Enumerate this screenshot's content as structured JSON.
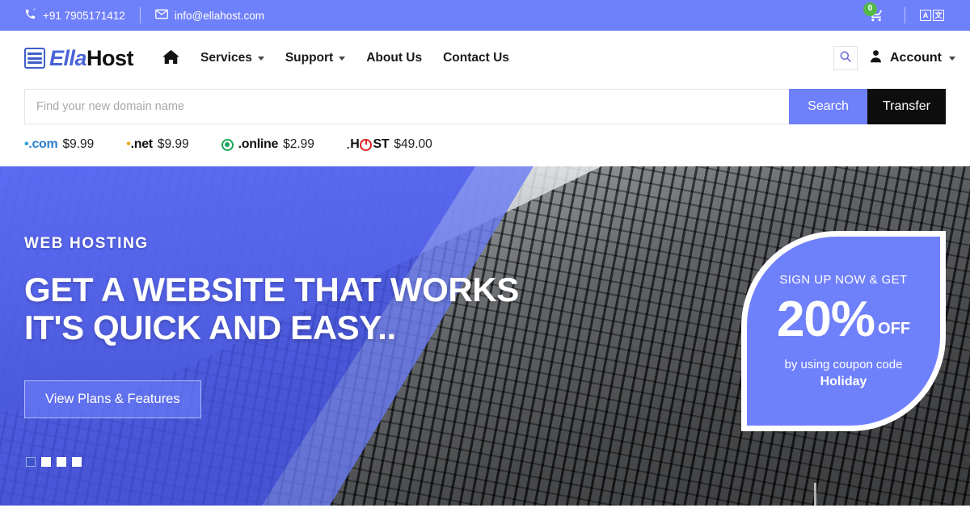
{
  "topbar": {
    "phone": "+91 7905171412",
    "phone_icon": "phone-ringing-icon",
    "email": "info@ellahost.com",
    "email_icon": "envelope-icon",
    "cart_icon": "shopping-cart-icon",
    "cart_count": "0",
    "cart_badge_color": "#53b846",
    "language_icon": "translate-icon",
    "lang_primary": "A",
    "lang_secondary": "文",
    "bg_color": "#6f80fb"
  },
  "header": {
    "logo": {
      "mark": "server-stack-icon",
      "part_one": "Ella",
      "part_two": "Host",
      "color_one": "#4a63d6",
      "color_two": "#111111"
    },
    "nav": [
      {
        "label": "",
        "icon": "home-icon",
        "has_caret": false
      },
      {
        "label": "Services",
        "icon": "",
        "has_caret": true
      },
      {
        "label": "Support",
        "icon": "",
        "has_caret": true
      },
      {
        "label": "About Us",
        "icon": "",
        "has_caret": false
      },
      {
        "label": "Contact Us",
        "icon": "",
        "has_caret": false
      }
    ],
    "search_toggle_icon": "search-icon",
    "account_icon": "user-icon",
    "account_label": "Account",
    "account_caret": true
  },
  "domain_search": {
    "placeholder": "Find your new domain name",
    "value": "",
    "search_label": "Search",
    "transfer_label": "Transfer",
    "search_color": "#6f80fb",
    "transfer_color": "#0d0d0d",
    "tlds": [
      {
        "name": ".com",
        "price": "$9.99",
        "icon": "com-dot-icon",
        "accent": "#2a9fd8"
      },
      {
        "name": ".net",
        "price": "$9.99",
        "icon": "net-dot-icon",
        "accent": "#f5a623"
      },
      {
        "name": ".online",
        "price": "$2.99",
        "icon": "online-ring-icon",
        "accent": "#18a558"
      },
      {
        "name": ".HOST",
        "price": "$49.00",
        "icon": "host-power-icon",
        "accent": "#e02020"
      }
    ]
  },
  "hero": {
    "eyebrow": "WEB HOSTING",
    "title": "GET A WEBSITE THAT WORKS IT'S QUICK AND EASY..",
    "cta_label": "View Plans & Features",
    "overlay_color": "#6f80fb",
    "slides": [
      {
        "active": true
      },
      {
        "active": false
      },
      {
        "active": false
      },
      {
        "active": false
      }
    ]
  },
  "promo": {
    "headline": "SIGN UP NOW & GET",
    "amount": "20%",
    "off_label": "OFF",
    "subtext": "by using coupon code",
    "code": "Holiday",
    "bg_color": "#6f80fb"
  }
}
